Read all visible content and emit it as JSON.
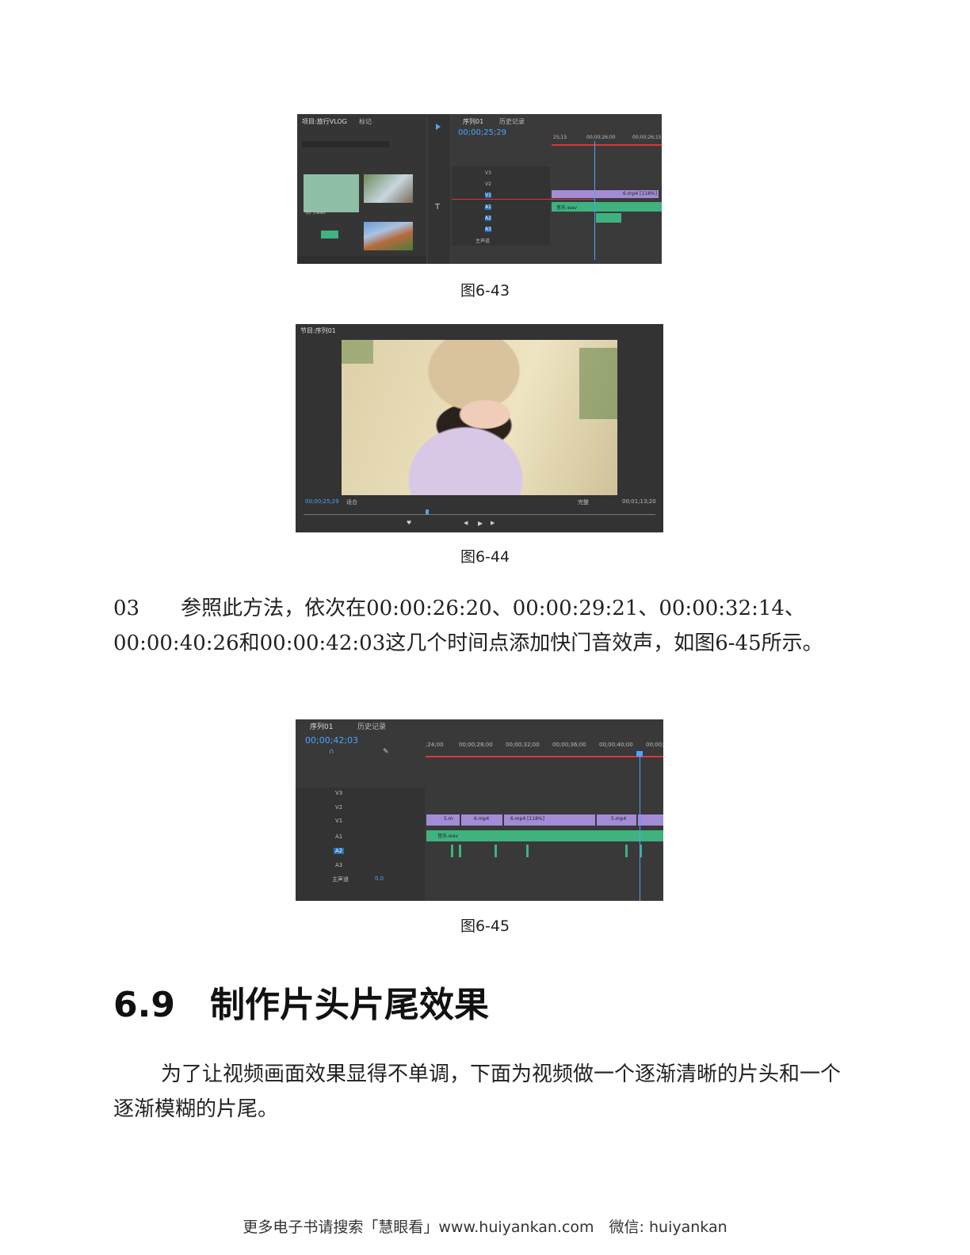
{
  "figures": [
    {
      "caption": "图6-43",
      "project_tab": "项目:旅行VLOG",
      "marker_tab": "标记",
      "sequence_tab": "序列01",
      "history_tab": "历史记录",
      "timecode": "00;00;25;29",
      "ruler_labels": [
        "25;15",
        "00;00;26;00",
        "00;00;26;15"
      ],
      "tracks": [
        "V3",
        "V2",
        "V1",
        "A1",
        "A2",
        "A3"
      ],
      "master_track": "主声道",
      "clips": {
        "video": "6.mp4 [118%]",
        "audio": "音乐.wav"
      },
      "bin_item": "快门.wav"
    },
    {
      "caption": "图6-44",
      "panel_tab": "节目:序列01",
      "timecode_left": "00;00;25;29",
      "fit_label": "适合",
      "quality_label": "完整",
      "timecode_right": "00;01;13;20"
    },
    {
      "caption": "图6-45",
      "sequence_tab": "序列01",
      "history_tab": "历史记录",
      "timecode": "00;00;42;03",
      "ruler_labels": [
        ";24;00",
        "00;00;28;00",
        "00;00;32;00",
        "00;00;36;00",
        "00;00;40;00",
        "00;00;"
      ],
      "tracks": [
        "V3",
        "V2",
        "V1",
        "A1",
        "A2",
        "A3"
      ],
      "master_track": "主声道",
      "master_value": "0.0",
      "clips": [
        "5.m",
        "6.mp4",
        "6.mp4 [118%]",
        "5.mp4"
      ],
      "audio_clip": "音乐.wav"
    }
  ],
  "step_paragraph": "03　　参照此方法，依次在00:00:26:20、00:00:29:21、00:00:32:14、00:00:40:26和00:00:42:03这几个时间点添加快门音效声，如图6-45所示。",
  "section_heading": "6.9　制作片头片尾效果",
  "body_paragraph": "为了让视频画面效果显得不单调，下面为视频做一个逐渐清晰的片头和一个逐渐模糊的片尾。",
  "footer": "更多电子书请搜索「慧眼看」www.huiyankan.com　微信: huiyankan",
  "colors": {
    "panel": "#3c3c3c",
    "video_clip": "#a48bd6",
    "audio_clip": "#3fb27f",
    "accent": "#4da3ff",
    "playhead_bar": "#d9363e"
  }
}
